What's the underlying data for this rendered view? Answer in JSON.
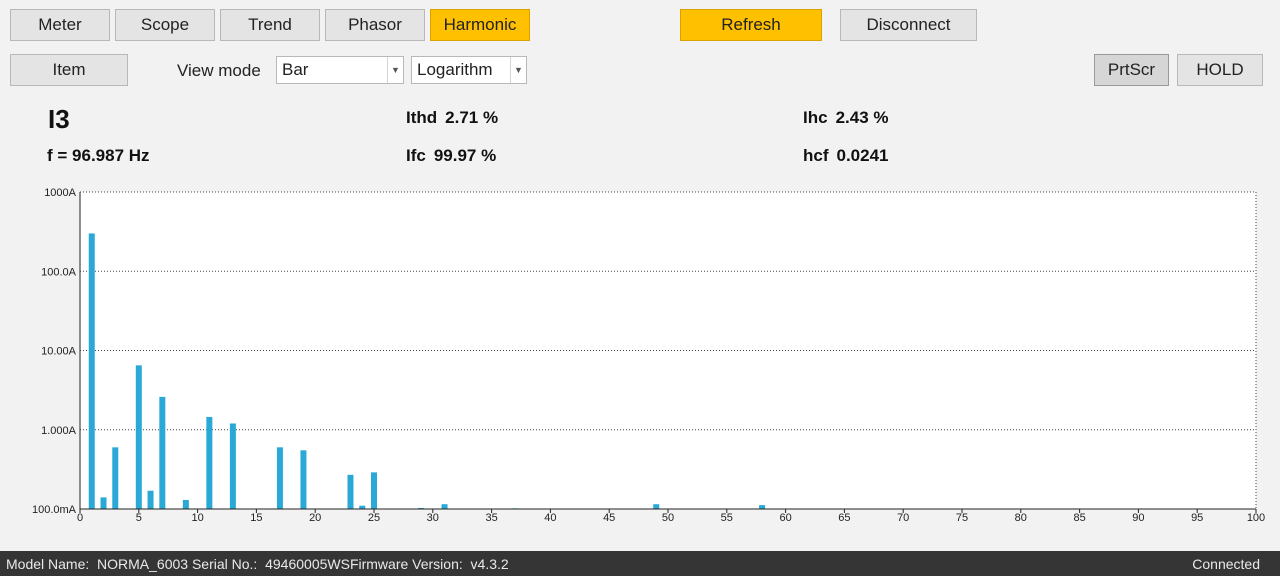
{
  "tabs": [
    {
      "label": "Meter"
    },
    {
      "label": "Scope"
    },
    {
      "label": "Trend"
    },
    {
      "label": "Phasor"
    },
    {
      "label": "Harmonic"
    }
  ],
  "active_tab": "Harmonic",
  "actions": {
    "refresh": "Refresh",
    "disconnect": "Disconnect"
  },
  "toolbar": {
    "item": "Item",
    "view_mode_label": "View mode",
    "view_mode_value": "Bar",
    "scale_value": "Logarithm",
    "prtscr": "PrtScr",
    "hold": "HOLD"
  },
  "readouts": {
    "channel": "I3",
    "frequency": "f = 96.987 Hz",
    "ithd_label": "Ithd",
    "ithd_value": "2.71 %",
    "ifc_label": "Ifc",
    "ifc_value": "99.97 %",
    "ihc_label": "Ihc",
    "ihc_value": "2.43 %",
    "hcf_label": "hcf",
    "hcf_value": "0.0241"
  },
  "status": {
    "model": "Model Name:  NORMA_6003 Serial No.:  49460005WSFirmware Version:  v4.3.2",
    "connection": "Connected"
  },
  "colors": {
    "accent": "#ffc000",
    "bar": "#2aa9d6",
    "status_bg": "#353535"
  },
  "chart_data": {
    "type": "bar",
    "y_scale": "log",
    "ylim": [
      0.1,
      1000
    ],
    "xlim": [
      0,
      100
    ],
    "y_ticks": [
      {
        "value": 1000,
        "label": "1000A"
      },
      {
        "value": 100,
        "label": "100.0A"
      },
      {
        "value": 10,
        "label": "10.00A"
      },
      {
        "value": 1,
        "label": "1.000A"
      },
      {
        "value": 0.1,
        "label": "100.0mA"
      }
    ],
    "x_ticks": [
      0,
      5,
      10,
      15,
      20,
      25,
      30,
      35,
      40,
      45,
      50,
      55,
      60,
      65,
      70,
      75,
      80,
      85,
      90,
      95,
      100
    ],
    "grid": "horizontal-dotted",
    "bars": [
      {
        "order": 1,
        "value": 300
      },
      {
        "order": 2,
        "value": 0.14
      },
      {
        "order": 3,
        "value": 0.6
      },
      {
        "order": 5,
        "value": 6.5
      },
      {
        "order": 6,
        "value": 0.17
      },
      {
        "order": 7,
        "value": 2.6
      },
      {
        "order": 9,
        "value": 0.13
      },
      {
        "order": 11,
        "value": 1.45
      },
      {
        "order": 13,
        "value": 1.2
      },
      {
        "order": 17,
        "value": 0.6
      },
      {
        "order": 19,
        "value": 0.55
      },
      {
        "order": 23,
        "value": 0.27
      },
      {
        "order": 24,
        "value": 0.11
      },
      {
        "order": 25,
        "value": 0.29
      },
      {
        "order": 29,
        "value": 0.103
      },
      {
        "order": 31,
        "value": 0.115
      },
      {
        "order": 37,
        "value": 0.102
      },
      {
        "order": 49,
        "value": 0.115
      },
      {
        "order": 58,
        "value": 0.112
      }
    ]
  }
}
